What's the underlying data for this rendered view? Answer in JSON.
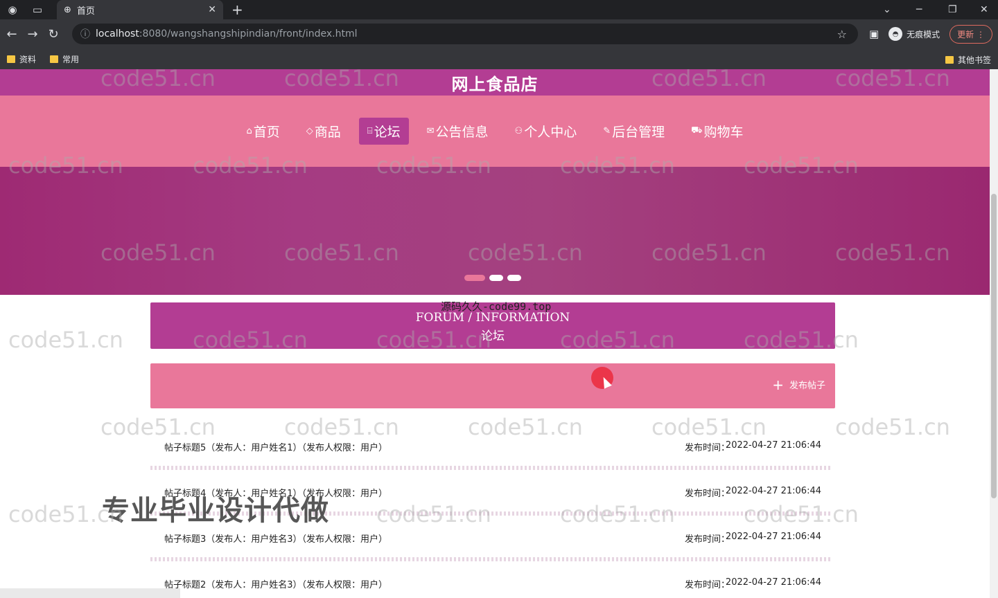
{
  "browser": {
    "tab_title": "首页",
    "url_host": "localhost",
    "url_rest": ":8080/wangshangshipindian/front/index.html",
    "incognito_label": "无痕模式",
    "update_label": "更新",
    "bookmarks": [
      {
        "label": "资料"
      },
      {
        "label": "常用"
      }
    ],
    "other_bookmarks": "其他书签"
  },
  "site": {
    "title": "网上食品店",
    "nav": [
      {
        "icon": "⌂",
        "label": "首页"
      },
      {
        "icon": "◇",
        "label": "商品"
      },
      {
        "icon": "⌸",
        "label": "论坛"
      },
      {
        "icon": "✉",
        "label": "公告信息"
      },
      {
        "icon": "⚇",
        "label": "个人中心"
      },
      {
        "icon": "✎",
        "label": "后台管理"
      },
      {
        "icon": "⛟",
        "label": "购物车"
      }
    ],
    "active_nav": "论坛"
  },
  "section": {
    "title_en": "FORUM / INFORMATION",
    "title_cn": "论坛",
    "overlay": "源码久久-code99.top"
  },
  "actions": {
    "post_button": "发布帖子"
  },
  "posts": [
    {
      "title": "帖子标题5（发布人：用户姓名1）（发布人权限：用户）",
      "time_label": "发布时间：",
      "time": "2022-04-27 21:06:44"
    },
    {
      "title": "帖子标题4（发布人：用户姓名1）（发布人权限：用户）",
      "time_label": "发布时间：",
      "time": "2022-04-27 21:06:44"
    },
    {
      "title": "帖子标题3（发布人：用户姓名3）（发布人权限：用户）",
      "time_label": "发布时间：",
      "time": "2022-04-27 21:06:44"
    },
    {
      "title": "帖子标题2（发布人：用户姓名3）（发布人权限：用户）",
      "time_label": "发布时间：",
      "time": "2022-04-27 21:06:44"
    }
  ],
  "watermark": "code51.cn",
  "promo": "专业毕业设计代做",
  "colors": {
    "primary": "#b33d93",
    "secondary": "#e9779a",
    "banner": "#a4417f"
  }
}
